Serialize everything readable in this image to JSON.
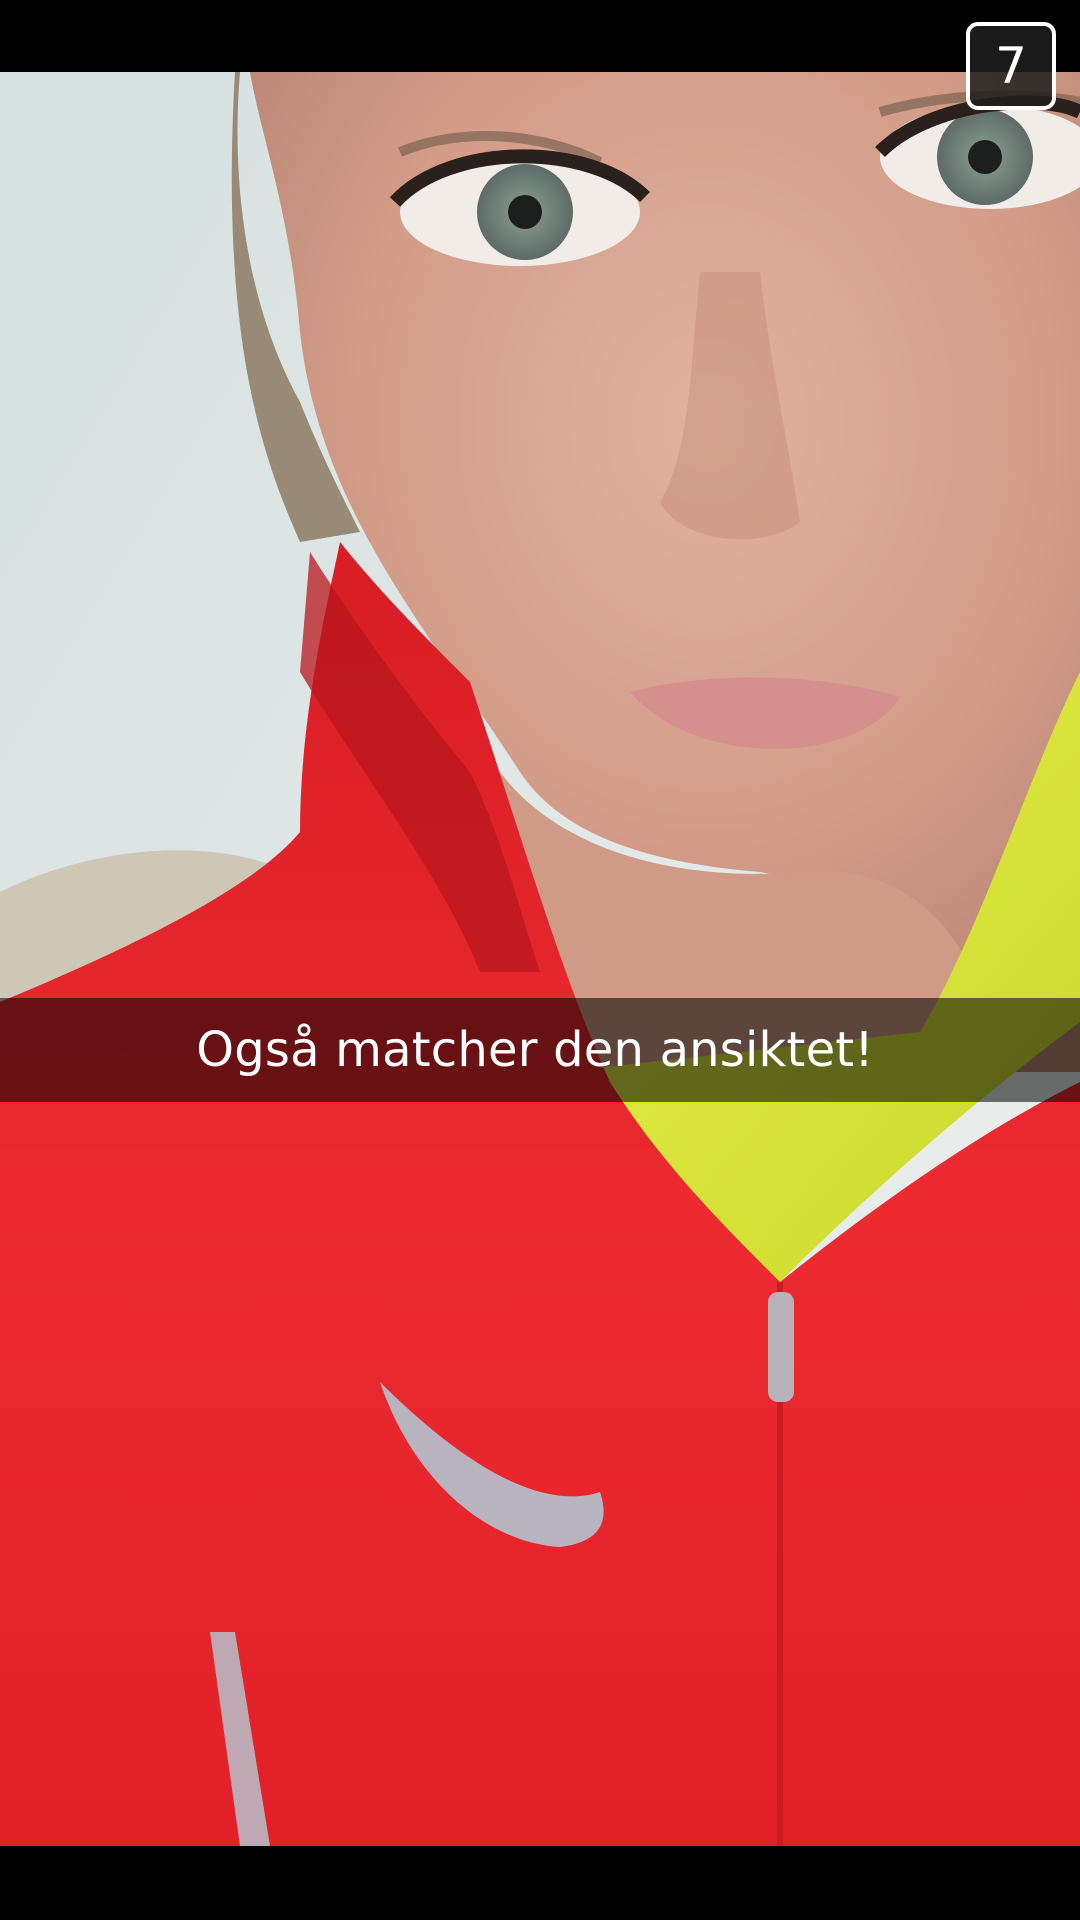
{
  "snap": {
    "timer_seconds": "7",
    "caption": "Også matcher den ansiktet!"
  },
  "icons": {
    "swoosh": "nike-swoosh-logo"
  },
  "colors": {
    "jacket_red": "#e8232a",
    "shirt_yellow": "#d9e83a",
    "skin": "#d9a894",
    "wall": "#e4eaea"
  }
}
